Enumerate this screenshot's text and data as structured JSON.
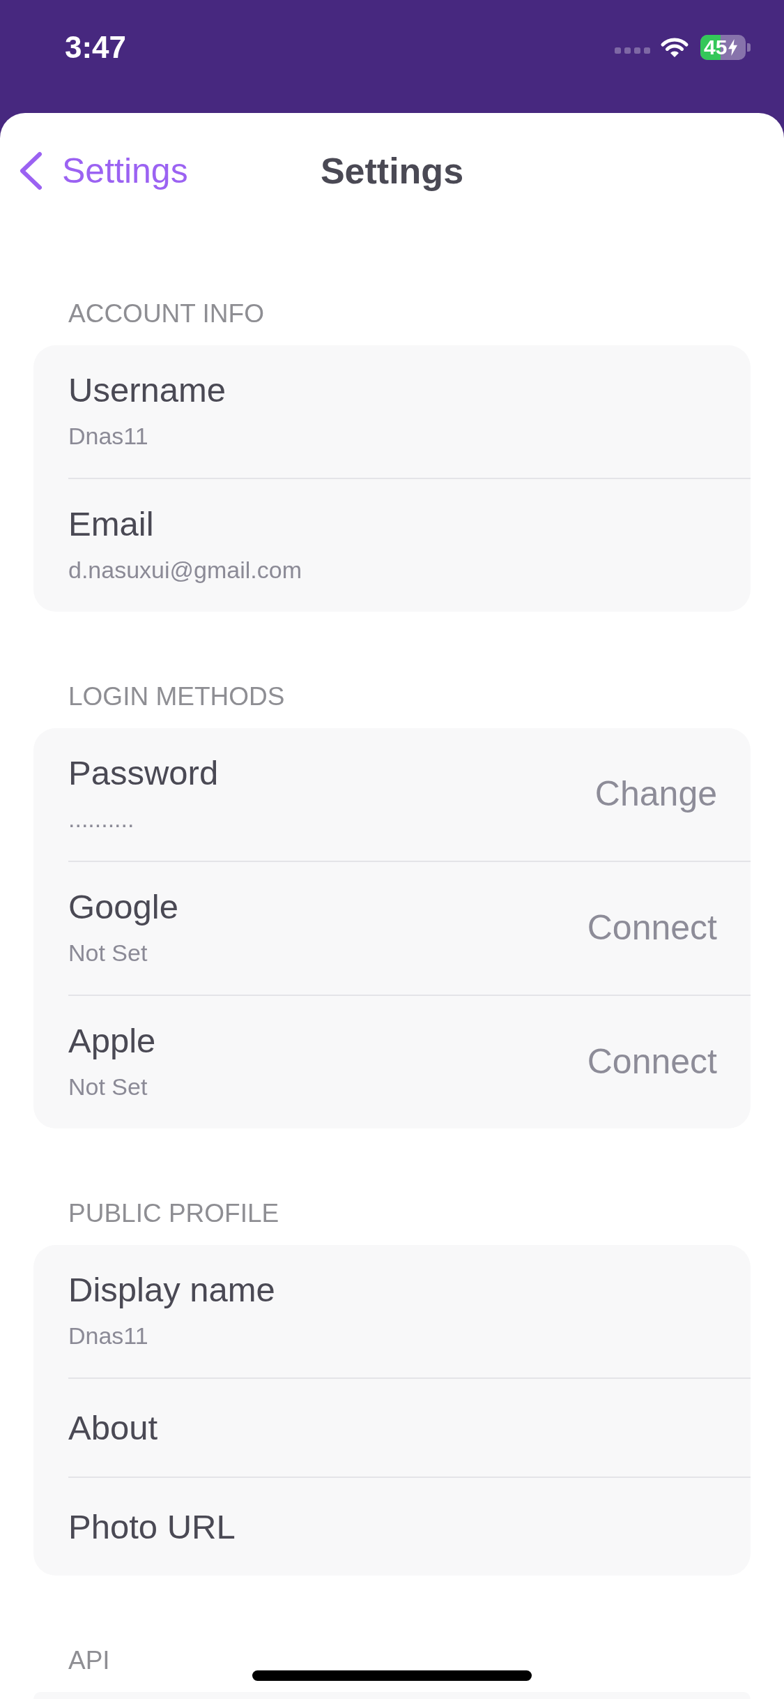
{
  "status_bar": {
    "time": "3:47",
    "battery": {
      "percent": "45",
      "charging": true
    }
  },
  "nav": {
    "back_label": "Settings",
    "title": "Settings"
  },
  "sections": [
    {
      "header": "ACCOUNT INFO",
      "rows": [
        {
          "title": "Username",
          "value": "Dnas11"
        },
        {
          "title": "Email",
          "value": "d.nasuxui@gmail.com"
        }
      ]
    },
    {
      "header": "LOGIN METHODS",
      "rows": [
        {
          "title": "Password",
          "value": "..........",
          "action": "Change"
        },
        {
          "title": "Google",
          "value": "Not Set",
          "action": "Connect"
        },
        {
          "title": "Apple",
          "value": "Not Set",
          "action": "Connect"
        }
      ]
    },
    {
      "header": "PUBLIC PROFILE",
      "rows": [
        {
          "title": "Display name",
          "value": "Dnas11"
        },
        {
          "title": "About"
        },
        {
          "title": "Photo URL"
        }
      ]
    },
    {
      "header": "API"
    }
  ]
}
